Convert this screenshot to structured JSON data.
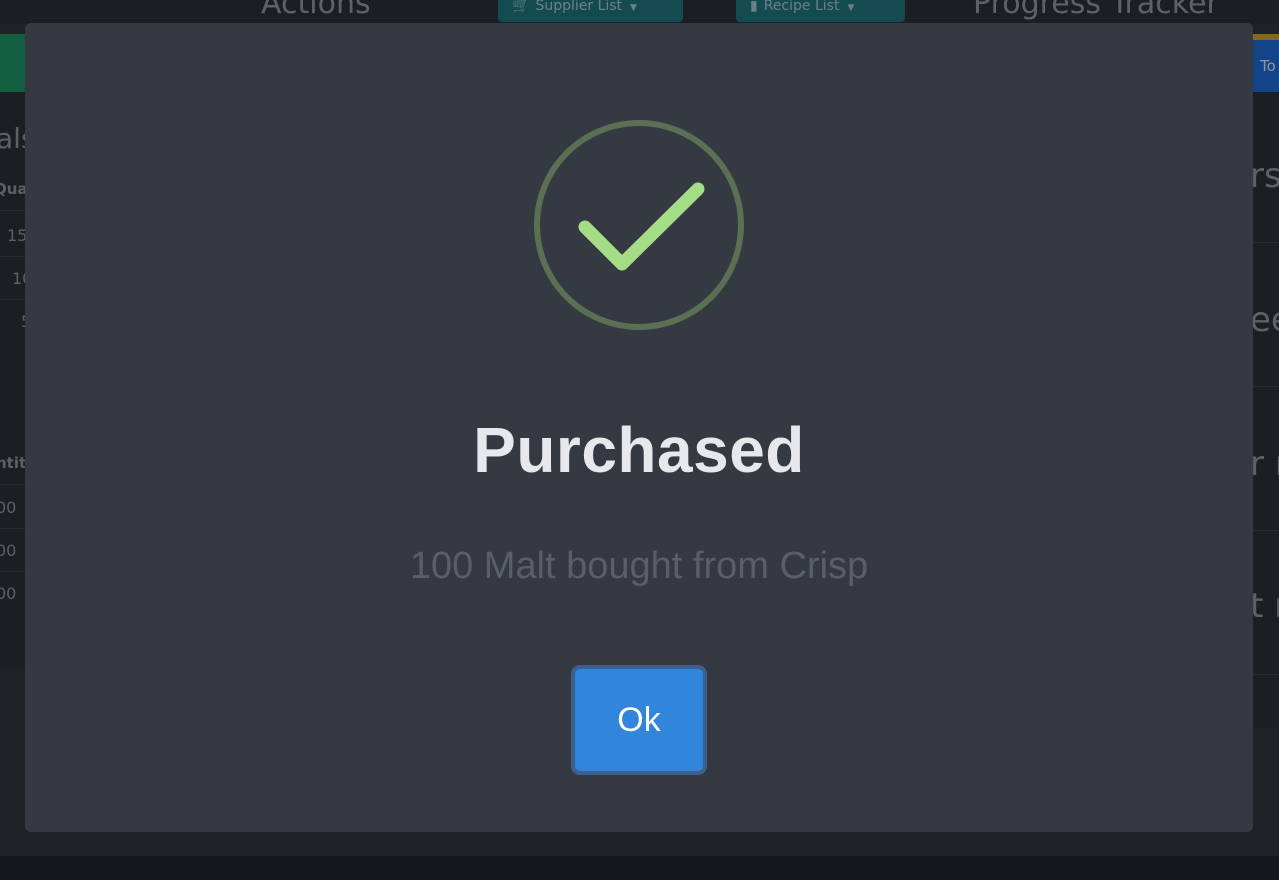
{
  "background": {
    "headings": {
      "actions": "Actions",
      "progress_tracker": "Progress Tracker"
    },
    "dropdowns": {
      "supplier_list": {
        "label": "Supplier List",
        "icon": "cart-icon"
      },
      "recipe_list": {
        "label": "Recipe List",
        "icon": "book-icon"
      }
    },
    "top_right_button": "To",
    "left_panel": {
      "heading_fragment": "als",
      "table1_header": "Quar",
      "table1_cells": [
        "15",
        "10",
        "5"
      ],
      "table2_header": "ntit",
      "table2_cells": [
        "00",
        "00",
        "00"
      ]
    },
    "right_panel": {
      "fragments": [
        "rs",
        "ee",
        "r n",
        "t n"
      ]
    }
  },
  "modal": {
    "icon": "checkmark-icon",
    "icon_colors": {
      "ring": "#5b6f55",
      "check": "#a5dc86"
    },
    "title": "Purchased",
    "message": "100 Malt bought from Crisp",
    "ok_label": "Ok",
    "ok_color": "#3185db"
  }
}
